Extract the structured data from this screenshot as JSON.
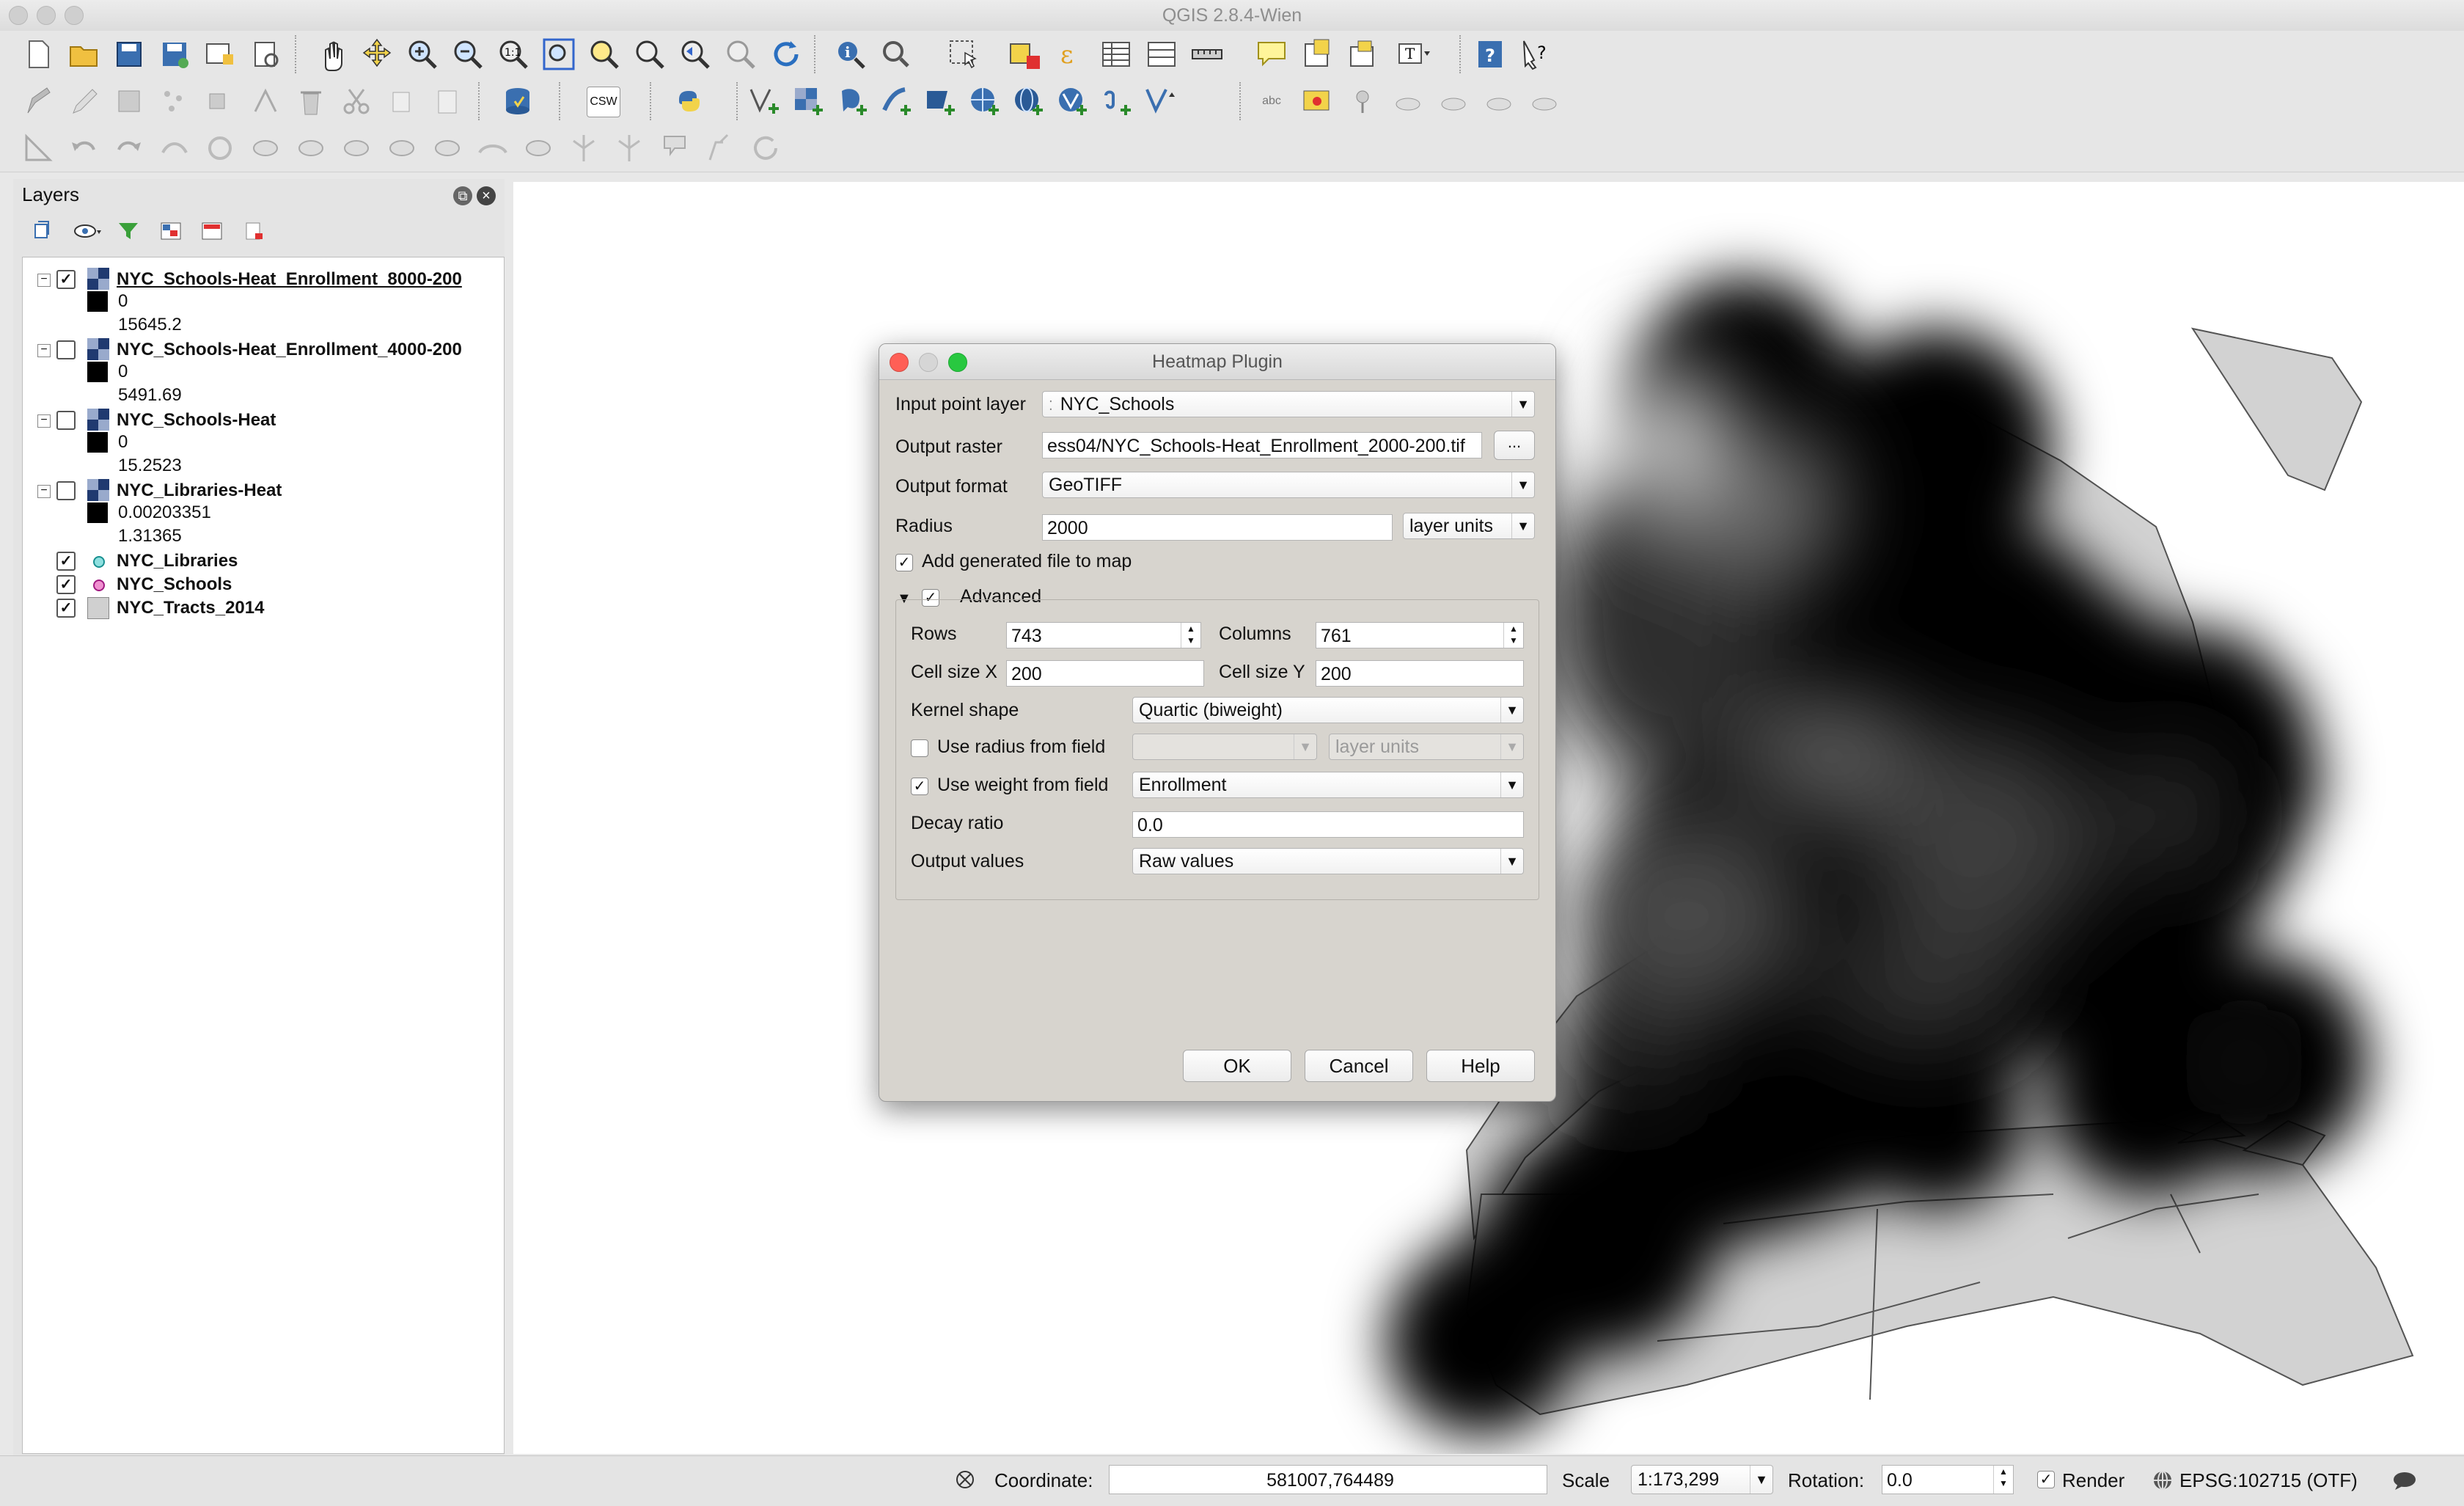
{
  "window": {
    "title": "QGIS 2.8.4-Wien"
  },
  "toolbars": {
    "row1": [
      "new-project-icon",
      "open-project-icon",
      "save-project-icon",
      "save-as-icon",
      "new-print-composer-icon",
      "composer-manager-icon",
      "pan-icon",
      "pan-to-selection-icon",
      "zoom-in-icon",
      "zoom-out-icon",
      "zoom-native-icon",
      "zoom-full-icon",
      "zoom-to-selection-icon",
      "zoom-to-layer-icon",
      "zoom-last-icon",
      "zoom-next-icon",
      "refresh-icon",
      "identify-icon",
      "action-icon",
      "select-features-icon",
      "deselect-icon",
      "field-calculator-icon",
      "attribute-table-icon",
      "statistics-icon",
      "measure-icon",
      "map-tips-icon",
      "new-bookmark-icon",
      "show-bookmarks-icon",
      "text-annotation-icon",
      "help-icon",
      "whats-this-icon"
    ],
    "row2_csw": "CSW",
    "row2_label": "abc"
  },
  "layers_panel": {
    "title": "Layers",
    "layers": [
      {
        "name": "NYC_Schools-Heat_Enrollment_8000-200",
        "checked": true,
        "type": "raster",
        "min": "0",
        "max": "15645.2",
        "underlined": true
      },
      {
        "name": "NYC_Schools-Heat_Enrollment_4000-200",
        "checked": false,
        "type": "raster",
        "min": "0",
        "max": "5491.69"
      },
      {
        "name": "NYC_Schools-Heat",
        "checked": false,
        "type": "raster",
        "min": "0",
        "max": "15.2523"
      },
      {
        "name": "NYC_Libraries-Heat",
        "checked": false,
        "type": "raster",
        "min": "0.00203351",
        "max": "1.31365"
      },
      {
        "name": "NYC_Libraries",
        "checked": true,
        "type": "point",
        "color": "#20a0a0"
      },
      {
        "name": "NYC_Schools",
        "checked": true,
        "type": "point",
        "color": "#c02090"
      },
      {
        "name": "NYC_Tracts_2014",
        "checked": true,
        "type": "polygon",
        "color": "#d0d0d0"
      }
    ]
  },
  "dialog": {
    "title": "Heatmap Plugin",
    "input_point_layer_label": "Input point layer",
    "input_point_layer_value": "NYC_Schools",
    "output_raster_label": "Output raster",
    "output_raster_value": "ess04/NYC_Schools-Heat_Enrollment_2000-200.tif",
    "browse_label": "...",
    "output_format_label": "Output format",
    "output_format_value": "GeoTIFF",
    "radius_label": "Radius",
    "radius_value": "2000",
    "radius_units": "layer units",
    "add_to_map_label": "Add generated file to map",
    "add_to_map_checked": true,
    "advanced_label": "Advanced",
    "advanced_checked": true,
    "rows_label": "Rows",
    "rows_value": "743",
    "columns_label": "Columns",
    "columns_value": "761",
    "cellx_label": "Cell size X",
    "cellx_value": "200",
    "celly_label": "Cell size Y",
    "celly_value": "200",
    "kernel_label": "Kernel shape",
    "kernel_value": "Quartic (biweight)",
    "radius_field_label": "Use radius from field",
    "radius_field_checked": false,
    "radius_field_units": "layer units",
    "weight_field_label": "Use weight from field",
    "weight_field_checked": true,
    "weight_field_value": "Enrollment",
    "decay_label": "Decay ratio",
    "decay_value": "0.0",
    "output_values_label": "Output values",
    "output_values_value": "Raw values",
    "ok_label": "OK",
    "cancel_label": "Cancel",
    "help_label": "Help"
  },
  "statusbar": {
    "coordinate_label": "Coordinate:",
    "coordinate_value": "581007,764489",
    "scale_label": "Scale",
    "scale_value": "1:173,299",
    "rotation_label": "Rotation:",
    "rotation_value": "0.0",
    "render_label": "Render",
    "render_checked": true,
    "crs_label": "EPSG:102715 (OTF)"
  }
}
